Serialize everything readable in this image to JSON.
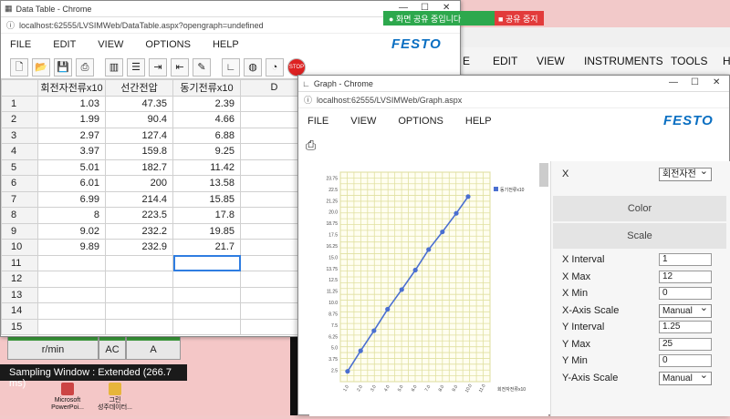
{
  "share_bar": {
    "sharing_text": "화면 공유 중입니다",
    "stop_label": "공유 중지"
  },
  "bg_app": {
    "menu": [
      "E",
      "EDIT",
      "VIEW",
      "INSTRUMENTS",
      "TOOLS",
      "H"
    ],
    "meters": [
      {
        "label": "r/min"
      },
      {
        "label": "AC"
      },
      {
        "label": "A"
      }
    ],
    "sampling": "Sampling Window : Extended (266.7 ms)",
    "desktop_icons": [
      {
        "line1": "Microsoft",
        "line2": "PowerPoi..."
      },
      {
        "line1": "그린",
        "line2": "성주데이터..."
      }
    ]
  },
  "data_window": {
    "title": "Data Table - Chrome",
    "url": "localhost:62555/LVSIMWeb/DataTable.aspx?opengraph=undefined",
    "menu": [
      "FILE",
      "EDIT",
      "VIEW",
      "OPTIONS",
      "HELP"
    ],
    "logo": "FESTO",
    "columns": [
      "회전자전류x10",
      "선간전압",
      "동기전류x10",
      "D"
    ],
    "rows": [
      {
        "n": "1",
        "a": "1.03",
        "b": "47.35",
        "c": "2.39"
      },
      {
        "n": "2",
        "a": "1.99",
        "b": "90.4",
        "c": "4.66"
      },
      {
        "n": "3",
        "a": "2.97",
        "b": "127.4",
        "c": "6.88"
      },
      {
        "n": "4",
        "a": "3.97",
        "b": "159.8",
        "c": "9.25"
      },
      {
        "n": "5",
        "a": "5.01",
        "b": "182.7",
        "c": "11.42"
      },
      {
        "n": "6",
        "a": "6.01",
        "b": "200",
        "c": "13.58"
      },
      {
        "n": "7",
        "a": "6.99",
        "b": "214.4",
        "c": "15.85"
      },
      {
        "n": "8",
        "a": "8",
        "b": "223.5",
        "c": "17.8"
      },
      {
        "n": "9",
        "a": "9.02",
        "b": "232.2",
        "c": "19.85"
      },
      {
        "n": "10",
        "a": "9.89",
        "b": "232.9",
        "c": "21.7"
      },
      {
        "n": "11",
        "a": "",
        "b": "",
        "c": ""
      },
      {
        "n": "12",
        "a": "",
        "b": "",
        "c": ""
      },
      {
        "n": "13",
        "a": "",
        "b": "",
        "c": ""
      },
      {
        "n": "14",
        "a": "",
        "b": "",
        "c": ""
      },
      {
        "n": "15",
        "a": "",
        "b": "",
        "c": ""
      }
    ]
  },
  "graph_window": {
    "title": "Graph - Chrome",
    "url": "localhost:62555/LVSIMWeb/Graph.aspx",
    "menu": [
      "FILE",
      "VIEW",
      "OPTIONS",
      "HELP"
    ],
    "logo": "FESTO",
    "panel": {
      "x_label": "X",
      "x_value": "회전자전",
      "color_label": "Color",
      "scale_label": "Scale",
      "fields": [
        {
          "label": "X Interval",
          "value": "1"
        },
        {
          "label": "X Max",
          "value": "12"
        },
        {
          "label": "X Min",
          "value": "0"
        },
        {
          "label": "X-Axis Scale",
          "value": "Manual",
          "select": true
        },
        {
          "label": "Y Interval",
          "value": "1.25"
        },
        {
          "label": "Y Max",
          "value": "25"
        },
        {
          "label": "Y Min",
          "value": "0"
        },
        {
          "label": "Y-Axis Scale",
          "value": "Manual",
          "select": true
        }
      ]
    }
  },
  "chart_data": {
    "type": "line",
    "xlabel": "회전자전류x10",
    "legend": "동기전류x10",
    "legend_position": "top-right",
    "grid": true,
    "x": [
      1.03,
      1.99,
      2.97,
      3.97,
      5.01,
      6.01,
      6.99,
      8,
      9.02,
      9.89
    ],
    "series": [
      {
        "name": "동기전류x10",
        "values": [
          2.39,
          4.66,
          6.88,
          9.25,
          11.42,
          13.58,
          15.85,
          17.8,
          19.85,
          21.7
        ]
      }
    ],
    "x_ticks": [
      "1.0",
      "2.0",
      "3.0",
      "4.0",
      "5.0",
      "6.0",
      "7.0",
      "8.0",
      "9.0",
      "10.0",
      "11.0"
    ],
    "y_ticks": [
      "2.5",
      "3.75",
      "5.0",
      "6.25",
      "7.5",
      "8.75",
      "10.0",
      "11.25",
      "12.5",
      "13.75",
      "15.0",
      "16.25",
      "17.5",
      "18.75",
      "20.0",
      "21.25",
      "22.5",
      "23.75"
    ],
    "xlim": [
      0.5,
      11.5
    ],
    "ylim": [
      1.25,
      24.4
    ],
    "color": "#4a6fd0"
  }
}
